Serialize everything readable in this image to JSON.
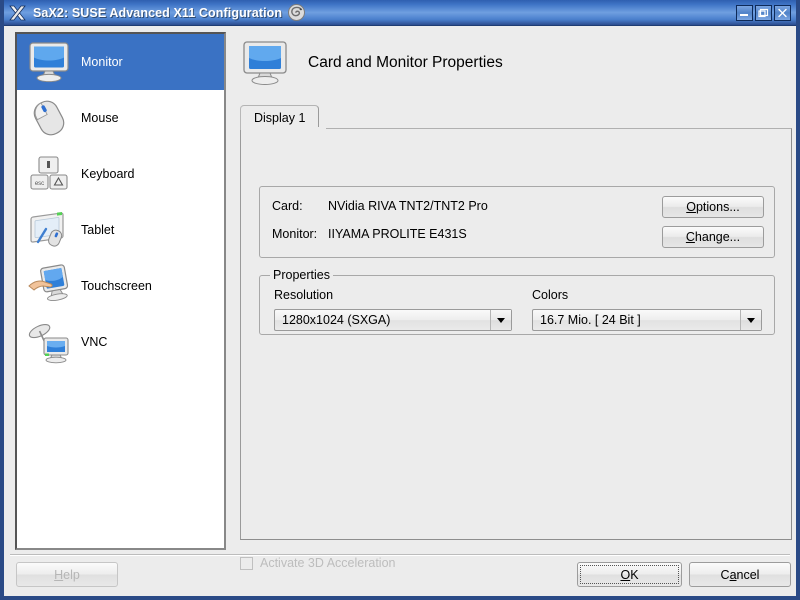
{
  "window": {
    "title": "SaX2: SUSE Advanced X11 Configuration",
    "app_icon": "x-logo-icon",
    "brand_icon": "suse-gecko-icon",
    "buttons": {
      "minimize": "minimize-icon",
      "maximize": "maximize-icon",
      "close": "close-icon"
    },
    "titlebar_color": "#4a7fcc",
    "frame_color": "#2a4a86"
  },
  "sidebar": {
    "selected_index": 0,
    "selection_color": "#3a72c4",
    "items": [
      {
        "label": "Monitor",
        "icon": "monitor-icon"
      },
      {
        "label": "Mouse",
        "icon": "mouse-icon"
      },
      {
        "label": "Keyboard",
        "icon": "keyboard-icon"
      },
      {
        "label": "Tablet",
        "icon": "tablet-icon"
      },
      {
        "label": "Touchscreen",
        "icon": "touchscreen-icon"
      },
      {
        "label": "VNC",
        "icon": "vnc-icon"
      }
    ]
  },
  "page": {
    "title": "Card and Monitor Properties",
    "icon": "monitor-icon"
  },
  "tabs": [
    {
      "label": "Display 1",
      "selected": true
    }
  ],
  "info": {
    "rows": [
      {
        "label": "Card:",
        "value": "NVidia RIVA TNT2/TNT2 Pro"
      },
      {
        "label": "Monitor:",
        "value": "IIYAMA PROLITE E431S"
      }
    ],
    "options_button": "Options...",
    "options_accel": "O",
    "change_button": "Change...",
    "change_accel": "C"
  },
  "properties": {
    "legend": "Properties",
    "resolution": {
      "label": "Resolution",
      "value": "1280x1024 (SXGA)"
    },
    "colors": {
      "label": "Colors",
      "value": "16.7 Mio. [ 24 Bit ]"
    }
  },
  "acceleration": {
    "label": "Activate 3D Acceleration",
    "checked": false,
    "enabled": false
  },
  "footer": {
    "help": "Help",
    "help_accel": "H",
    "help_enabled": false,
    "ok": "OK",
    "ok_accel": "O",
    "ok_focused": true,
    "cancel": "Cancel",
    "cancel_accel": "a"
  }
}
